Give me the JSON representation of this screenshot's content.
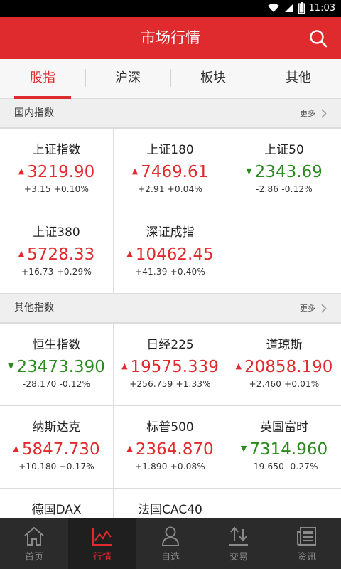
{
  "status_bar": {
    "time": "11:03"
  },
  "header": {
    "title": "市场行情"
  },
  "tabs": [
    {
      "label": "股指",
      "active": true
    },
    {
      "label": "沪深",
      "active": false
    },
    {
      "label": "板块",
      "active": false
    },
    {
      "label": "其他",
      "active": false
    }
  ],
  "sections": [
    {
      "title": "国内指数",
      "more_label": "更多",
      "items": [
        {
          "name": "上证指数",
          "price": "3219.90",
          "change": "+3.15",
          "pct": "+0.10%",
          "direction": "up"
        },
        {
          "name": "上证180",
          "price": "7469.61",
          "change": "+2.91",
          "pct": "+0.04%",
          "direction": "up"
        },
        {
          "name": "上证50",
          "price": "2343.69",
          "change": "-2.86",
          "pct": "-0.12%",
          "direction": "down"
        },
        {
          "name": "上证380",
          "price": "5728.33",
          "change": "+16.73",
          "pct": "+0.29%",
          "direction": "up"
        },
        {
          "name": "深证成指",
          "price": "10462.45",
          "change": "+41.39",
          "pct": "+0.40%",
          "direction": "up"
        }
      ]
    },
    {
      "title": "其他指数",
      "more_label": "更多",
      "items": [
        {
          "name": "恒生指数",
          "price": "23473.390",
          "change": "-28.170",
          "pct": "-0.12%",
          "direction": "down"
        },
        {
          "name": "日经225",
          "price": "19575.339",
          "change": "+256.759",
          "pct": "+1.33%",
          "direction": "up"
        },
        {
          "name": "道琼斯",
          "price": "20858.190",
          "change": "+2.460",
          "pct": "+0.01%",
          "direction": "up"
        },
        {
          "name": "纳斯达克",
          "price": "5847.730",
          "change": "+10.180",
          "pct": "+0.17%",
          "direction": "up"
        },
        {
          "name": "标普500",
          "price": "2364.870",
          "change": "+1.890",
          "pct": "+0.08%",
          "direction": "up"
        },
        {
          "name": "英国富时",
          "price": "7314.960",
          "change": "-19.650",
          "pct": "-0.27%",
          "direction": "down"
        },
        {
          "name": "德国DAX",
          "price": "",
          "change": "",
          "pct": "",
          "direction": ""
        },
        {
          "name": "法国CAC40",
          "price": "",
          "change": "",
          "pct": "",
          "direction": ""
        }
      ]
    }
  ],
  "bottom_nav": [
    {
      "label": "首页",
      "icon": "home-icon",
      "active": false
    },
    {
      "label": "行情",
      "icon": "chart-icon",
      "active": true
    },
    {
      "label": "自选",
      "icon": "user-icon",
      "active": false
    },
    {
      "label": "交易",
      "icon": "trade-icon",
      "active": false
    },
    {
      "label": "资讯",
      "icon": "news-icon",
      "active": false
    }
  ],
  "colors": {
    "brand_red": "#e02b2e",
    "up": "#e02b2e",
    "down": "#2a8a1e",
    "nav_bg": "#2b2b2b"
  }
}
